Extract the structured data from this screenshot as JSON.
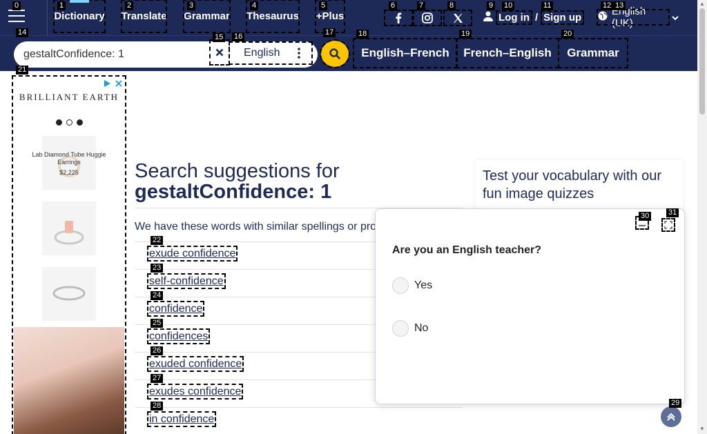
{
  "nav": {
    "menu_icon": "hamburger-icon",
    "items": [
      {
        "label": "Dictionary",
        "active": true
      },
      {
        "label": "Translate"
      },
      {
        "label": "Grammar"
      },
      {
        "label": "Thesaurus"
      },
      {
        "label": "+Plus"
      }
    ],
    "social": [
      "facebook-icon",
      "instagram-icon",
      "x-twitter-icon"
    ],
    "login_label": "Log in",
    "login_sep": "/",
    "signup_label": "Sign up",
    "language_label": "English (UK)"
  },
  "search": {
    "value": "gestaltConfidence: 1",
    "dataset_label": "English",
    "quick_links": [
      "English–French",
      "French–English",
      "Grammar"
    ]
  },
  "ad": {
    "brand": "BRILLIANT EARTH",
    "product_name": "Lab Diamond Tube Huggie Earrings",
    "product_price": "$2,225"
  },
  "main": {
    "heading_prefix": "Search suggestions for",
    "heading_term": "gestaltConfidence: 1",
    "intro": "We have these words with similar spellings or pronunciations:",
    "suggestions": [
      "exude confidence",
      "self-confidence",
      "confidence",
      "confidences",
      "exuded confidence",
      "exudes confidence",
      "in confidence"
    ]
  },
  "sidebar": {
    "quiz_title": "Test your vocabulary with our fun image quizzes"
  },
  "popup": {
    "question": "Are you an English teacher?",
    "options": [
      "Yes",
      "No"
    ]
  },
  "tags": [
    "0",
    "1",
    "2",
    "3",
    "4",
    "5",
    "6",
    "7",
    "8",
    "9",
    "10",
    "11",
    "12",
    "13",
    "14",
    "15",
    "16",
    "17",
    "18",
    "19",
    "20",
    "21",
    "22",
    "23",
    "24",
    "25",
    "26",
    "27",
    "28",
    "29",
    "30",
    "31"
  ],
  "colors": {
    "header_bg": "#1d2a57",
    "accent_yellow": "#fec400",
    "active_indicator": "#7fd3f7",
    "text_primary": "#1d2a57"
  }
}
